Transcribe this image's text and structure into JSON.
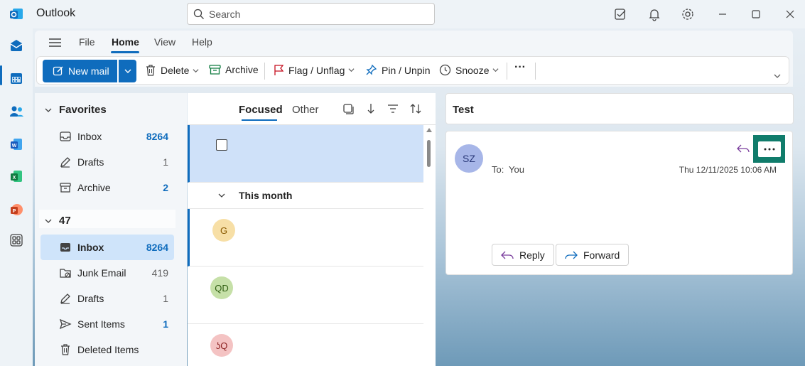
{
  "app": {
    "title": "Outlook"
  },
  "search": {
    "placeholder": "Search"
  },
  "menu": {
    "tabs": [
      "File",
      "Home",
      "View",
      "Help"
    ],
    "active": "Home"
  },
  "toolbar": {
    "new_mail": "New mail",
    "delete": "Delete",
    "archive": "Archive",
    "flag": "Flag / Unflag",
    "pin": "Pin / Unpin",
    "snooze": "Snooze",
    "more": "···"
  },
  "favorites": {
    "label": "Favorites",
    "items": [
      {
        "name": "Inbox",
        "count": "8264"
      },
      {
        "name": "Drafts",
        "count": "1"
      },
      {
        "name": "Archive",
        "count": "2"
      }
    ]
  },
  "account": {
    "label": "47",
    "items": [
      {
        "name": "Inbox",
        "count": "8264"
      },
      {
        "name": "Junk Email",
        "count": "419"
      },
      {
        "name": "Drafts",
        "count": "1"
      },
      {
        "name": "Sent Items",
        "count": "1"
      },
      {
        "name": "Deleted Items",
        "count": ""
      }
    ]
  },
  "message_list": {
    "tabs": [
      "Focused",
      "Other"
    ],
    "section": "This month",
    "messages": [
      {
        "initials": "G",
        "color": "#f7dfa6",
        "text_color": "#8a5a00"
      },
      {
        "initials": "QD",
        "color": "#c6e0a8",
        "text_color": "#2f5e11"
      },
      {
        "initials": "ʖQ",
        "color": "#f4c3c3",
        "text_color": "#8a1f1f"
      }
    ]
  },
  "reading": {
    "subject": "Test",
    "sender_initials": "SZ",
    "to_label": "To:",
    "to_value": "You",
    "date": "Thu 12/11/2025 10:06 AM",
    "reply": "Reply",
    "forward": "Forward"
  },
  "colors": {
    "accent": "#0f6cbd",
    "selected": "#cfe4fa",
    "more_highlight": "#107c6b"
  }
}
